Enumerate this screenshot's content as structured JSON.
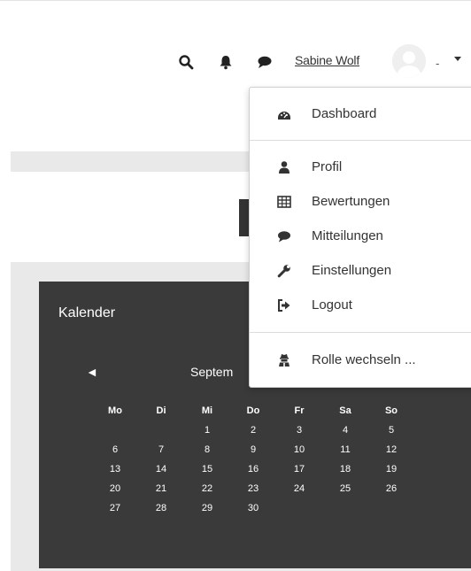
{
  "navbar": {
    "icons": [
      "search-icon",
      "bell-icon",
      "chat-bubble-icon"
    ],
    "username": "Sabine Wolf",
    "user_suffix": "-"
  },
  "user_menu": {
    "items": [
      {
        "label": "Dashboard",
        "icon": "dashboard-icon"
      },
      {
        "label": "Profil",
        "icon": "user-icon"
      },
      {
        "label": "Bewertungen",
        "icon": "table-icon"
      },
      {
        "label": "Mitteilungen",
        "icon": "chat-bubble-icon"
      },
      {
        "label": "Einstellungen",
        "icon": "wrench-icon"
      },
      {
        "label": "Logout",
        "icon": "sign-out-icon"
      },
      {
        "label": "Rolle wechseln ...",
        "icon": "user-secret-icon"
      }
    ]
  },
  "calendar": {
    "title": "Kalender",
    "prev_symbol": "◄",
    "month_partial": "Septem",
    "weekdays": [
      "Mo",
      "Di",
      "Mi",
      "Do",
      "Fr",
      "Sa",
      "So"
    ],
    "weeks": [
      [
        "",
        "",
        "1",
        "2",
        "3",
        "4",
        "5"
      ],
      [
        "6",
        "7",
        "8",
        "9",
        "10",
        "11",
        "12"
      ],
      [
        "13",
        "14",
        "15",
        "16",
        "17",
        "18",
        "19"
      ],
      [
        "20",
        "21",
        "22",
        "23",
        "24",
        "25",
        "26"
      ],
      [
        "27",
        "28",
        "29",
        "30",
        "",
        "",
        ""
      ]
    ]
  },
  "colors": {
    "calendar_bg": "#3a3a3a",
    "page_band": "#e9e9e9",
    "text": "#333333"
  }
}
